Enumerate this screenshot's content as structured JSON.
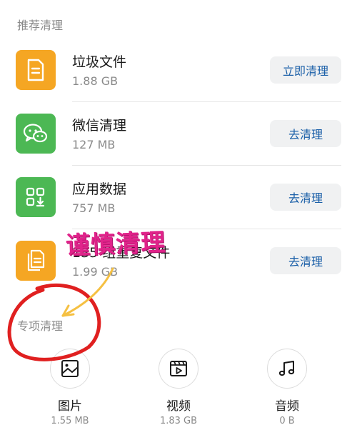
{
  "recommended": {
    "title": "推荐清理",
    "items": [
      {
        "name": "垃圾文件",
        "size": "1.88 GB",
        "button": "立即清理",
        "icon": "file-icon",
        "color": "#f5a623"
      },
      {
        "name": "微信清理",
        "size": "127 MB",
        "button": "去清理",
        "icon": "wechat-icon",
        "color": "#4cb854"
      },
      {
        "name": "应用数据",
        "size": "757 MB",
        "button": "去清理",
        "icon": "app-grid-icon",
        "color": "#4cb854"
      },
      {
        "name": "135 组重复文件",
        "size": "1.99 GB",
        "button": "去清理",
        "icon": "duplicate-file-icon",
        "color": "#f5a623"
      }
    ]
  },
  "special": {
    "title": "专项清理",
    "tools": [
      {
        "name": "图片",
        "size": "1.55 MB",
        "icon": "image-icon"
      },
      {
        "name": "视频",
        "size": "1.83 GB",
        "icon": "video-icon"
      },
      {
        "name": "音频",
        "size": "0 B",
        "icon": "music-icon"
      }
    ]
  },
  "annotation": {
    "text": "谨慎清理",
    "color": "#e0238a",
    "circle_color": "#e02020",
    "arrow_color": "#f5c042"
  }
}
